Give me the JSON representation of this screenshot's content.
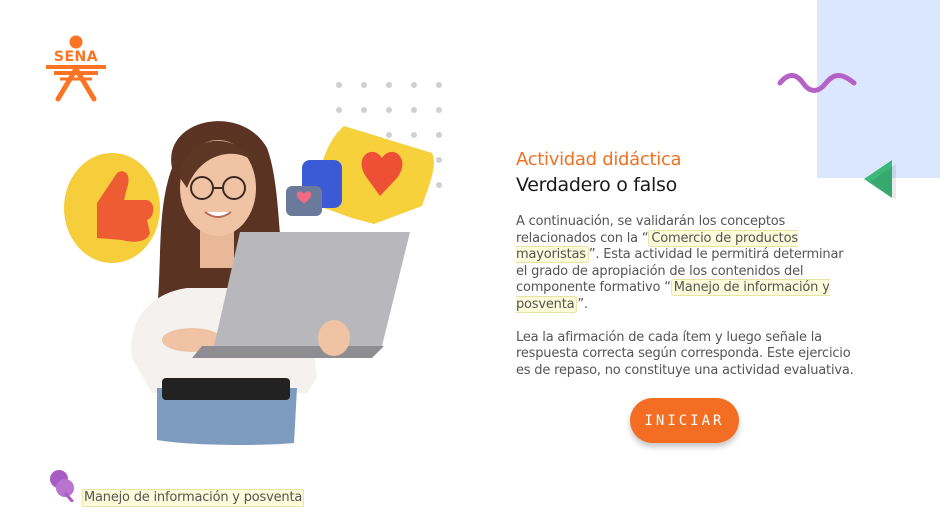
{
  "logo": {
    "text": "SENA"
  },
  "header": {
    "kicker": "Actividad didáctica",
    "title": "Verdadero o falso"
  },
  "intro": {
    "part1": "A continuación, se validarán los conceptos relacionados con la “",
    "highlight1": "Comercio de productos mayoristas",
    "part2": "”.  Esta actividad le permitirá determinar el grado de apropiación de los contenidos del componente formativo “",
    "highlight2": "Manejo de información y posventa",
    "part3": "”."
  },
  "instructions": "Lea la afirmación de cada ítem y luego señale la respuesta correcta según corresponda.  Este ejercicio es de repaso, no constituye una actividad evaluativa.",
  "start_button": {
    "label": "INICIAR"
  },
  "footer": {
    "module_label": "Manejo de información y posventa"
  },
  "colors": {
    "accent": "#f36d22",
    "panel": "#dbe6ff",
    "squiggle": "#b462c6",
    "triangle": "#3cb878",
    "highlight_bg": "#fdfbd9"
  },
  "icons": [
    "sena-logo",
    "squiggle-decoration",
    "triangle-decoration",
    "thumbs-up-bubble-icon",
    "heart-bubble-icon",
    "chat-bubble-icon",
    "pin-icon"
  ]
}
